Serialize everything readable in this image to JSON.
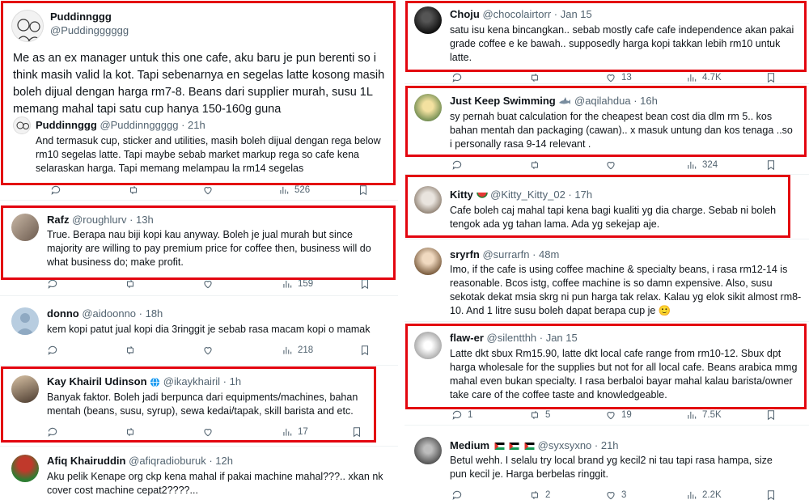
{
  "colors": {
    "highlight_box": "#e3050f",
    "muted": "#536471",
    "text": "#0f1419"
  },
  "left": {
    "tweets": [
      {
        "name": "Puddinnggg",
        "handle": "@Puddingggggg",
        "text": "Me as an ex manager untuk this one cafe, aku baru je pun berenti so i think masih valid la kot. Tapi sebenarnya en segelas latte kosong masih boleh dijual dengan harga rm7-8. Beans dari supplier murah, susu 1L memang mahal tapi satu cup hanya 150-160g guna",
        "quote": {
          "name": "Puddinnggg",
          "handle": "@Puddinnggggg · 21h",
          "text": "And termasuk cup, sticker and utilities, masih boleh dijual dengan rega below rm10 segelas latte. Tapi maybe sebab market markup rega so cafe kena selaraskan harga. Tapi memang melampau la rm14 segelas"
        },
        "actions": {
          "views": "526"
        }
      },
      {
        "name": "Rafz",
        "handle": "@roughlurv · 13h",
        "text": "True. Berapa nau biji kopi kau anyway. Boleh je jual murah but since majority are willing to pay premium price for coffee then, business will do what business do; make profit.",
        "actions": {
          "views": "159"
        }
      },
      {
        "name": "donno",
        "handle": "@aidoonno · 18h",
        "text": "kem kopi patut jual kopi dia 3ringgit je sebab rasa macam kopi o mamak",
        "actions": {
          "views": "218"
        }
      },
      {
        "name": "Kay Khairil Udinson",
        "handle": "@ikaykhairil · 1h",
        "text": "Banyak faktor. Boleh jadi berpunca dari equipments/machines, bahan mentah (beans, susu, syrup), sewa kedai/tapak, skill barista and etc.",
        "actions": {
          "views": "17"
        }
      },
      {
        "name": "Afiq Khairuddin",
        "handle": "@afiqradioburuk · 12h",
        "text": "Aku pelik Kenape org ckp kena mahal if pakai machine mahal???.. xkan nk cover cost machine cepat2????..."
      }
    ]
  },
  "right": {
    "tweets": [
      {
        "name": "Choju",
        "handle": "@chocolairtorr · Jan 15",
        "text": "satu isu kena bincangkan.. sebab mostly cafe cafe independence akan pakai grade coffee e ke bawah.. supposedly harga kopi takkan lebih rm10 untuk latte.",
        "actions": {
          "likes": "13",
          "views": "4.7K"
        }
      },
      {
        "name": "Just Keep Swimming",
        "handle": "@aqilahdua · 16h",
        "text": "sy pernah buat calculation for the cheapest bean cost dia dlm rm 5.. kos bahan mentah dan packaging (cawan).. x masuk untung dan kos tenaga ..so i personally rasa 9-14 relevant .",
        "actions": {
          "views": "324"
        }
      },
      {
        "name": "Kitty",
        "handle": "@Kitty_Kitty_02 · 17h",
        "text": "Cafe boleh caj mahal tapi kena bagi kualiti yg dia charge. Sebab ni boleh tengok ada yg tahan lama. Ada yg sekejap aje."
      },
      {
        "name": "sryrfn",
        "handle": "@surrarfn · 48m",
        "text": "Imo, if the cafe is using coffee machine & specialty beans, i rasa rm12-14 is reasonable. Bcos istg, coffee machine is so damn expensive. Also, susu sekotak dekat msia skrg ni pun harga tak relax. Kalau yg elok sikit almost rm8-10. And 1 litre susu boleh dapat berapa cup je 🙂"
      },
      {
        "name": "flaw-er",
        "handle": "@silentthh · Jan 15",
        "text": "Latte dkt sbux Rm15.90, latte dkt local cafe range from rm10-12. Sbux dpt harga wholesale for the supplies but not for all local cafe. Beans arabica mmg mahal even bukan specialty. I rasa berbaloi bayar mahal kalau barista/owner take care of the coffee taste and knowledgeable.",
        "actions": {
          "replies": "1",
          "retweets": "5",
          "likes": "19",
          "views": "7.5K"
        }
      },
      {
        "name": "Medium",
        "handle": "@syxsyxno · 21h",
        "text": "Betul wehh. I selalu try local brand yg kecil2 ni tau tapi rasa hampa, size pun kecil je. Harga berbelas ringgit.",
        "actions": {
          "retweets": "2",
          "likes": "3",
          "views": "2.2K"
        }
      }
    ]
  }
}
